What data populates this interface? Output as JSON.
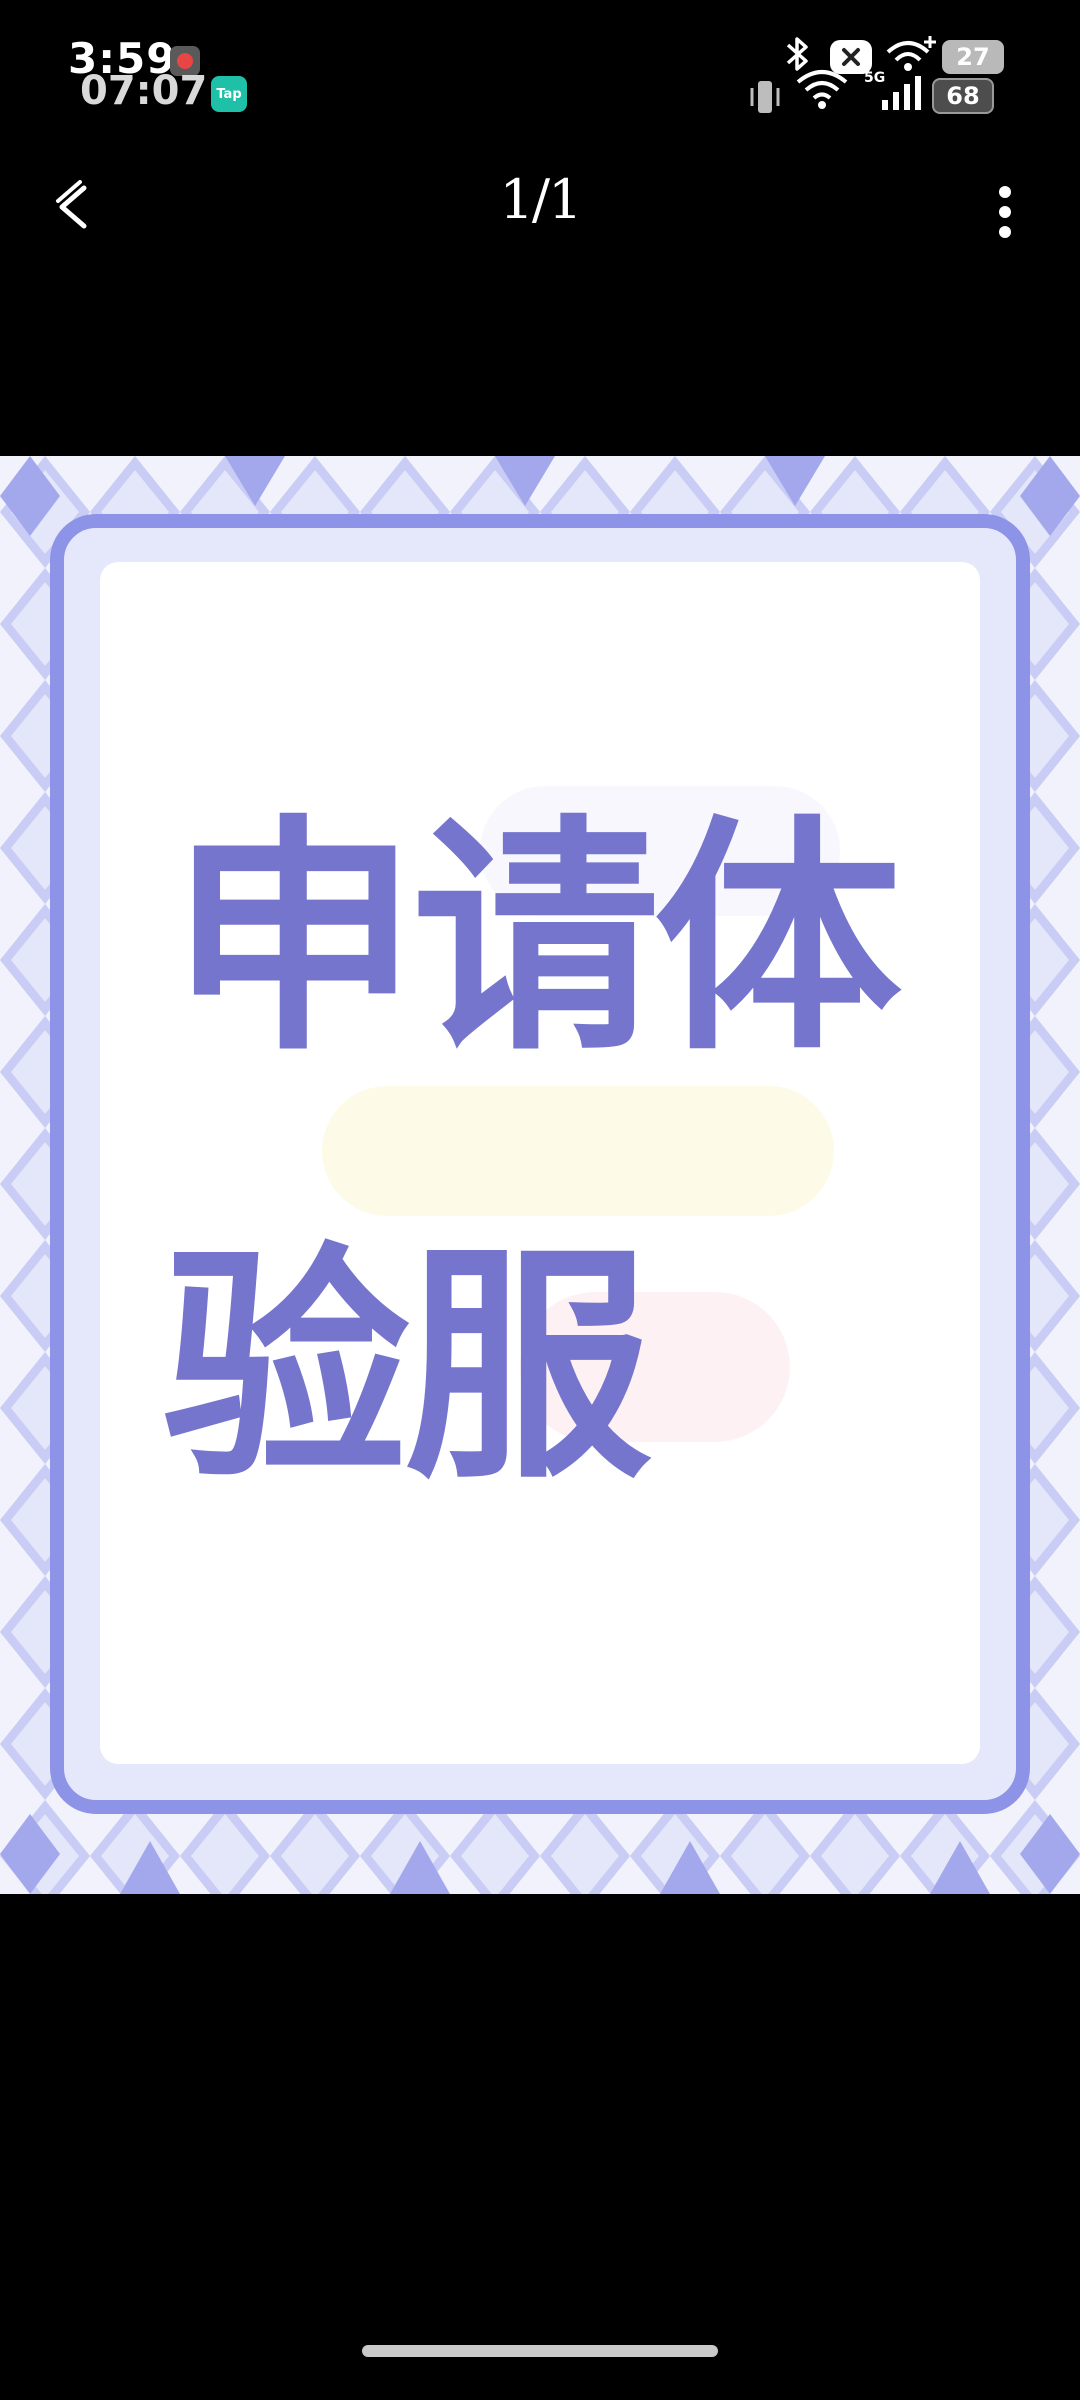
{
  "status_bar": {
    "time_primary": "3:59",
    "time_secondary": "07:07",
    "tap_badge": "Tap",
    "network_type": "5G",
    "battery_top": "27",
    "battery_bottom": "68"
  },
  "top_bar": {
    "page_indicator": "1/1"
  },
  "image": {
    "headline_line1": "申请体",
    "headline_line2": "验服"
  },
  "icons": [
    "notification-icon",
    "tap-app-icon",
    "vibrate-icon",
    "bluetooth-icon",
    "wifi-icon",
    "do-not-disturb-icon",
    "signal-icon",
    "battery-icon",
    "back-arrow-icon",
    "more-vert-icon"
  ],
  "colors": {
    "headline": "#7575cd",
    "frame": "#8d93e6",
    "pattern": "#a3a8ec"
  }
}
